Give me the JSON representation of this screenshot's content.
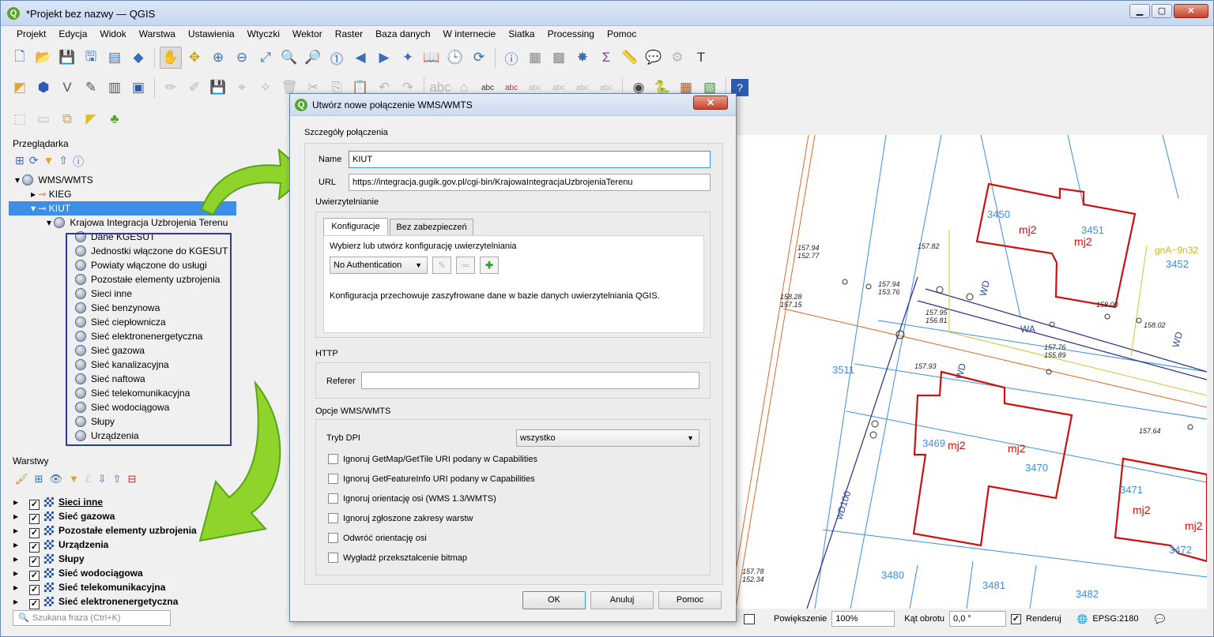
{
  "window": {
    "title": "*Projekt bez nazwy — QGIS"
  },
  "menu": [
    "Projekt",
    "Edycja",
    "Widok",
    "Warstwa",
    "Ustawienia",
    "Wtyczki",
    "Wektor",
    "Raster",
    "Baza danych",
    "W internecie",
    "Siatka",
    "Processing",
    "Pomoc"
  ],
  "browser": {
    "title": "Przeglądarka",
    "root": "WMS/WMTS",
    "items": [
      "KIEG",
      "KIUT"
    ],
    "service": "Krajowa Integracja Uzbrojenia Terenu",
    "layers": [
      "Dane KGESUT",
      "Jednostki włączone do KGESUT",
      "Powiaty włączone do usługi",
      "Pozostałe elementy uzbrojenia",
      "Sieci inne",
      "Sieć benzynowa",
      "Sieć ciepłownicza",
      "Sieć elektronenergetyczna",
      "Sieć gazowa",
      "Sieć kanalizacyjna",
      "Sieć naftowa",
      "Sieć telekomunikacyjna",
      "Sieć wodociągowa",
      "Słupy",
      "Urządzenia"
    ]
  },
  "layers_panel": {
    "title": "Warstwy",
    "items": [
      "Sieci inne",
      "Sieć gazowa",
      "Pozostałe elementy uzbrojenia",
      "Urządzenia",
      "Słupy",
      "Sieć wodociągowa",
      "Sieć telekomunikacyjna",
      "Sieć elektronenergetyczna"
    ],
    "search_placeholder": "Szukana fraza (Ctrl+K)"
  },
  "dialog": {
    "title": "Utwórz nowe połączenie WMS/WMTS",
    "section_details": "Szczegóły połączenia",
    "name_label": "Name",
    "name_value": "KIUT",
    "url_label": "URL",
    "url_value": "https://integracja.gugik.gov.pl/cgi-bin/KrajowaIntegracjaUzbrojeniaTerenu",
    "auth_title": "Uwierzytelnianie",
    "tab_config": "Konfiguracje",
    "tab_basic": "Bez zabezpieczeń",
    "auth_hint": "Wybierz lub utwórz konfigurację uwierzytelniania",
    "auth_combo": "No Authentication",
    "auth_info": "Konfiguracja przechowuje zaszyfrowane dane w bazie danych uwierzytelniania QGIS.",
    "http_title": "HTTP",
    "referer_label": "Referer",
    "referer_value": "",
    "options_title": "Opcje WMS/WMTS",
    "dpi_label": "Tryb DPI",
    "dpi_value": "wszystko",
    "options": [
      "Ignoruj GetMap/GetTile URI podany w Capabilities",
      "Ignoruj GetFeatureInfo URI podany w Capabilities",
      "Ignoruj orientację osi (WMS 1.3/WMTS)",
      "Ignoruj zgłoszone zakresy warstw",
      "Odwróć orientację osi",
      "Wygładź przekształcenie bitmap"
    ],
    "ok": "OK",
    "cancel": "Anuluj",
    "help": "Pomoc"
  },
  "map": {
    "parcels": [
      "3450",
      "3451",
      "3452",
      "3511",
      "3469",
      "3470",
      "3471",
      "3472",
      "3480",
      "3481",
      "3482"
    ],
    "building_label": "mj2",
    "network_labels": [
      "WA",
      "WD",
      "WD",
      "WD",
      "wD100",
      "gnA~9n32"
    ],
    "heights": [
      "157.94",
      "152.77",
      "157.82",
      "158.28",
      "157.15",
      "157.94",
      "153.76",
      "157.95",
      "156.81",
      "158.00",
      "158.02",
      "157.76",
      "155.89",
      "157.93",
      "157.64",
      "157.78",
      "152.34"
    ]
  },
  "status": {
    "zoom_label": "Powiększenie",
    "zoom_value": "100%",
    "rotation_label": "Kąt obrotu",
    "rotation_value": "0,0 °",
    "render_label": "Renderuj",
    "crs": "EPSG:2180"
  }
}
